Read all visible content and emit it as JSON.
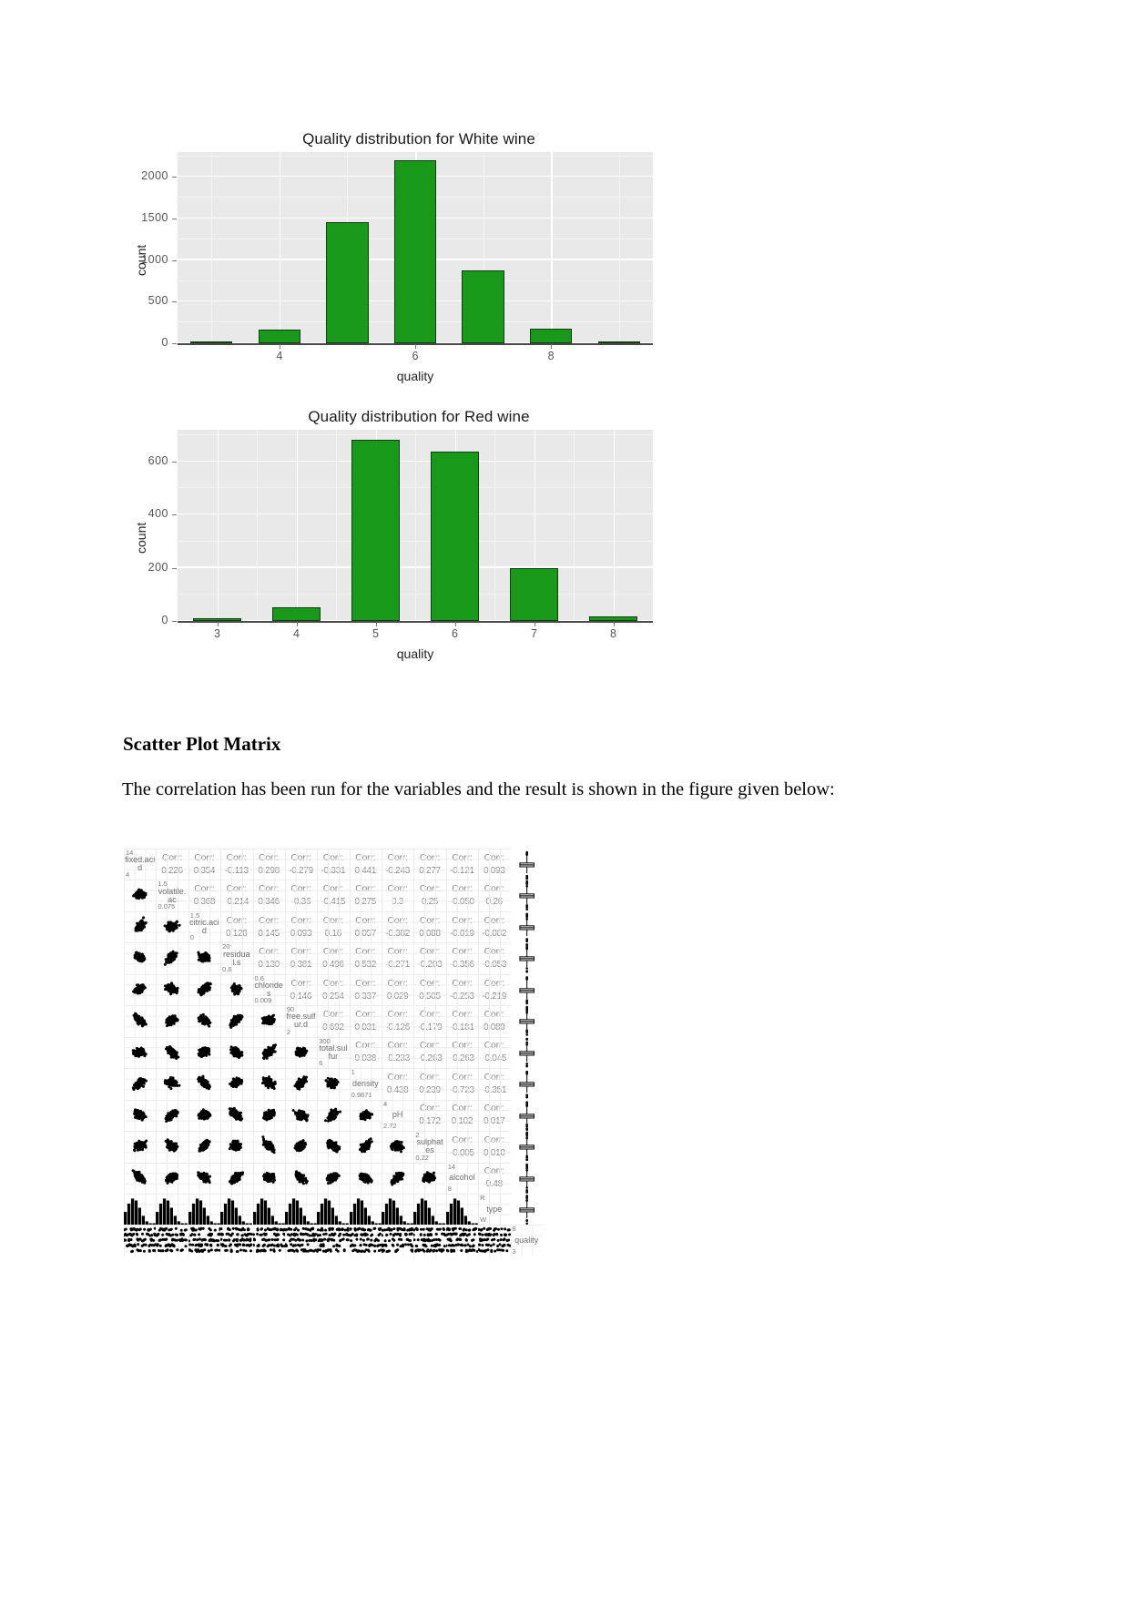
{
  "document": {
    "heading": "Scatter Plot Matrix",
    "paragraph": "The correlation has been run for the variables and the result is shown in the figure given below:"
  },
  "chart_data": [
    {
      "type": "bar",
      "id": "white-wine",
      "title": "Quality distribution for White wine",
      "xlabel": "quality",
      "ylabel": "count",
      "categories": [
        3,
        4,
        5,
        6,
        7,
        8,
        9
      ],
      "values": [
        20,
        163,
        1457,
        2198,
        880,
        175,
        5
      ],
      "xlim": [
        2.5,
        9.5
      ],
      "ylim": [
        0,
        2300
      ],
      "xticks": [
        4,
        6,
        8
      ],
      "xtick_labels": [
        "4",
        "6",
        "8"
      ],
      "yticks": [
        0,
        500,
        1000,
        1500,
        2000
      ],
      "ytick_labels": [
        "0",
        "500",
        "1000",
        "1500",
        "2000"
      ],
      "bar_color": "#199919",
      "bar_border": "#0f3f12",
      "panel_color": "#e9e9e9",
      "grid": true
    },
    {
      "type": "bar",
      "id": "red-wine",
      "title": "Quality distribution for Red wine",
      "xlabel": "quality",
      "ylabel": "count",
      "categories": [
        3,
        4,
        5,
        6,
        7,
        8
      ],
      "values": [
        10,
        53,
        681,
        638,
        199,
        18
      ],
      "xlim": [
        2.5,
        8.5
      ],
      "ylim": [
        0,
        720
      ],
      "xticks": [
        3,
        4,
        5,
        6,
        7,
        8
      ],
      "xtick_labels": [
        "3",
        "4",
        "5",
        "6",
        "7",
        "8"
      ],
      "yticks": [
        0,
        200,
        400,
        600
      ],
      "ytick_labels": [
        "0",
        "200",
        "400",
        "600"
      ],
      "bar_color": "#199919",
      "bar_border": "#0f3f12",
      "panel_color": "#e9e9e9",
      "grid": true
    },
    {
      "type": "scatter",
      "id": "scatter-plot-matrix",
      "title": "",
      "layout": "pair-matrix",
      "variables": [
        "fixed.acidity",
        "volatile.acidity",
        "citric.acid",
        "residual.sugar",
        "chlorides",
        "free.sulfur.dioxide",
        "total.sulfur.dioxide",
        "density",
        "pH",
        "sulphates",
        "alcohol",
        "type",
        "quality"
      ],
      "diag_labels": [
        {
          "name": "fixed.acid",
          "top": "14",
          "bot": "4"
        },
        {
          "name": "volatile.ac",
          "top": "1.5",
          "bot": "0.075"
        },
        {
          "name": "citric.acid",
          "top": "1.5",
          "bot": "0"
        },
        {
          "name": "residual.s",
          "top": "20",
          "bot": "0.6"
        },
        {
          "name": "chlorides",
          "top": "0.6",
          "bot": "0.009"
        },
        {
          "name": "free.sulfur.d",
          "top": "90",
          "bot": "2"
        },
        {
          "name": "total.sulfur",
          "top": "300",
          "bot": "6"
        },
        {
          "name": "density",
          "top": "1",
          "bot": "0.9871"
        },
        {
          "name": "pH",
          "top": "4",
          "bot": "2.72"
        },
        {
          "name": "sulphates",
          "top": "2",
          "bot": "0.22"
        },
        {
          "name": "alcohol",
          "top": "14",
          "bot": "8"
        },
        {
          "name": "type",
          "top": "R",
          "bot": "W"
        },
        {
          "name": "quality",
          "top": "8",
          "bot": "3"
        }
      ],
      "corr_label": "Corr:",
      "correlations": [
        [
          "0.226",
          "0.354",
          "-0.113",
          "0.298",
          "-0.279",
          "-0.331",
          "0.441",
          "-0.243",
          "0.277",
          "-0.121",
          "0.093"
        ],
        [
          "0.368",
          "-0.214",
          "0.346",
          "-0.36",
          "-0.415",
          "0.275",
          "0.3",
          "0.25",
          "-0.050",
          "0.26"
        ],
        [
          "0.128",
          "0.145",
          "0.093",
          "0.16",
          "0.057",
          "-0.382",
          "0.088",
          "-0.019",
          "-0.082"
        ],
        [
          "0.130",
          "0.381",
          "0.496",
          "0.532",
          "-0.271",
          "-0.203",
          "-0.356",
          "-0.053"
        ],
        [
          "0.146",
          "0.254",
          "0.337",
          "0.029",
          "0.505",
          "-0.253",
          "-0.219"
        ],
        [
          "0.692",
          "0.031",
          "-0.126",
          "-0.179",
          "-0.181",
          "0.089"
        ],
        [
          "0.038",
          "-0.233",
          "-0.263",
          "-0.263",
          "-0.045"
        ],
        [
          "0.438",
          "0.239",
          "-0.723",
          "-0.351"
        ],
        [
          "0.172",
          "0.102",
          "0.017"
        ],
        [
          "-0.005",
          "0.010"
        ],
        [
          "0.48"
        ]
      ],
      "boxplot_column_label": "type",
      "xlabel": "",
      "ylabel": ""
    }
  ]
}
